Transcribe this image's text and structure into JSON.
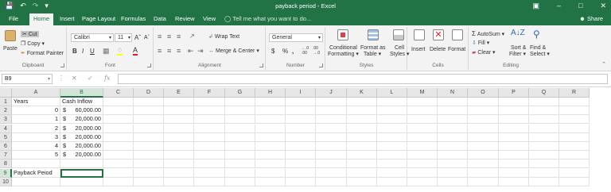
{
  "window": {
    "title": "payback period - Excel",
    "qat_icons": [
      "save-icon",
      "undo-icon",
      "redo-icon",
      "customize-qat-icon"
    ],
    "controls": [
      "ribbon-display-icon",
      "minimize-icon",
      "maximize-icon",
      "close-icon"
    ]
  },
  "tabs": [
    "File",
    "Home",
    "Insert",
    "Page Layout",
    "Formulas",
    "Data",
    "Review",
    "View"
  ],
  "active_tab": "Home",
  "tell_me": "Tell me what you want to do...",
  "share": "Share",
  "ribbon": {
    "clipboard": {
      "label": "Clipboard",
      "paste": "Paste",
      "cut": "Cut",
      "copy": "Copy",
      "format_painter": "Format Painter"
    },
    "font": {
      "label": "Font",
      "name": "Calibri",
      "size": "11",
      "bold": "B",
      "italic": "I",
      "underline": "U"
    },
    "alignment": {
      "label": "Alignment",
      "wrap": "Wrap Text",
      "merge": "Merge & Center"
    },
    "number": {
      "label": "Number",
      "format": "General",
      "currency": "$",
      "percent": "%",
      "comma": ","
    },
    "styles": {
      "label": "Styles",
      "cond1": "Conditional",
      "cond2": "Formatting",
      "fmt1": "Format as",
      "fmt2": "Table",
      "cell1": "Cell",
      "cell2": "Styles"
    },
    "cells": {
      "label": "Cells",
      "insert": "Insert",
      "delete": "Delete",
      "format": "Format"
    },
    "editing": {
      "label": "Editing",
      "autosum": "AutoSum",
      "fill": "Fill",
      "clear": "Clear",
      "sort1": "Sort &",
      "sort2": "Filter",
      "find1": "Find &",
      "find2": "Select"
    }
  },
  "formula_bar": {
    "name_box": "B9",
    "fx": "fx",
    "value": ""
  },
  "columns": [
    "A",
    "B",
    "C",
    "D",
    "E",
    "F",
    "G",
    "H",
    "I",
    "J",
    "K",
    "L",
    "M",
    "N",
    "O",
    "P",
    "Q",
    "R"
  ],
  "rows": [
    "1",
    "2",
    "3",
    "4",
    "5",
    "6",
    "7",
    "8",
    "9",
    "10"
  ],
  "cells": {
    "A1": "Years",
    "B1": "Cash Inflow",
    "A2": "0",
    "B2": "60,000.00",
    "A3": "1",
    "B3": "20,000.00",
    "A4": "2",
    "B4": "20,000.00",
    "A5": "3",
    "B5": "20,000.00",
    "A6": "4",
    "B6": "20,000.00",
    "A7": "5",
    "B7": "20,000.00",
    "A9": "Payback Peiod"
  },
  "currency_symbol": "$",
  "active_cell": "B9",
  "colors": {
    "accent": "#217346",
    "ribbon_bg": "#f3f3f3",
    "header_bg": "#e6e6e6"
  }
}
